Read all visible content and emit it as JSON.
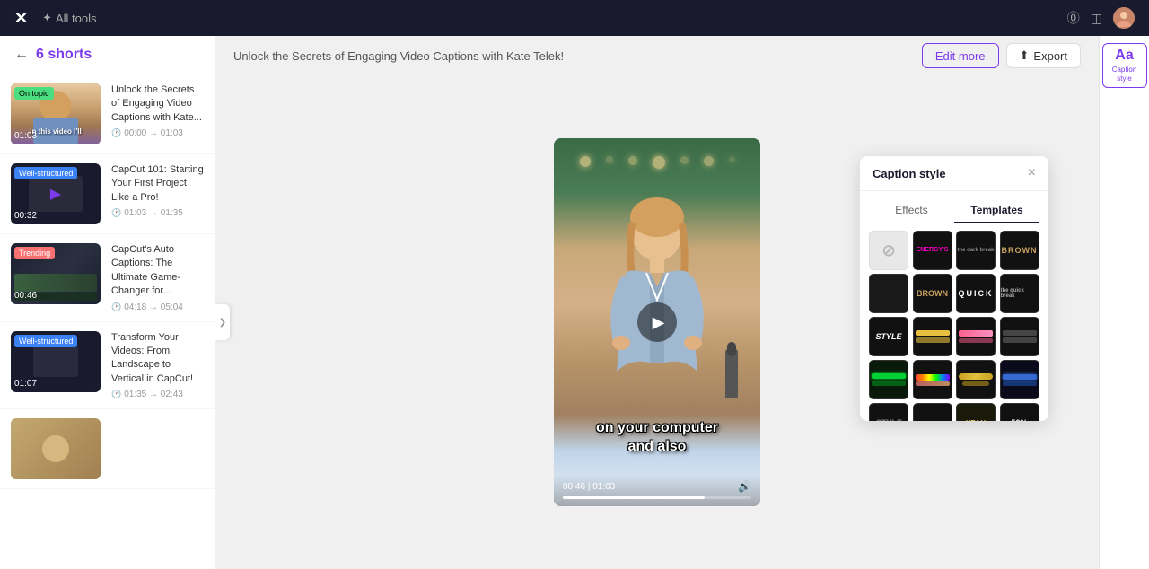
{
  "topnav": {
    "logo": "✕",
    "alltools_label": "All tools",
    "help_icon": "?",
    "history_icon": "📋",
    "avatar": "👤"
  },
  "sidebar": {
    "back_label": "←",
    "count": "6",
    "title": "shorts",
    "items": [
      {
        "id": "item-1",
        "badge": "On topic",
        "badge_type": "ontopic",
        "duration": "01:03",
        "title": "Unlock the Secrets of Engaging Video Captions with Kate...",
        "time_range": "00:00 → 01:03",
        "thumb_class": "thumb-gradient-1",
        "has_person": true,
        "caption_text": "in this video I'll"
      },
      {
        "id": "item-2",
        "badge": "Well-structured",
        "badge_type": "wellstructured",
        "duration": "00:32",
        "title": "CapCut 101: Starting Your First Project Like a Pro!",
        "time_range": "01:03 → 01:35",
        "thumb_class": "thumb-gradient-2",
        "has_person": false
      },
      {
        "id": "item-3",
        "badge": "Trending",
        "badge_type": "trending",
        "duration": "00:46",
        "title": "CapCut's Auto Captions: The Ultimate Game-Changer for...",
        "time_range": "04:18 → 05:04",
        "thumb_class": "thumb-gradient-3",
        "has_person": false
      },
      {
        "id": "item-4",
        "badge": "Well-structured",
        "badge_type": "wellstructured",
        "duration": "01:07",
        "title": "Transform Your Videos: From Landscape to Vertical in CapCut!",
        "time_range": "01:35 → 02:43",
        "thumb_class": "thumb-gradient-4",
        "has_person": false
      }
    ]
  },
  "content_header": {
    "text": "Unlock the Secrets of Engaging Video Captions with Kate Telek!",
    "edit_more_label": "Edit more",
    "export_label": "Export",
    "export_icon": "⬆"
  },
  "video": {
    "current_time": "00:46",
    "total_time": "01:03",
    "progress_pct": 75,
    "caption_line1": "on your computer",
    "caption_line2": "and also"
  },
  "caption_panel": {
    "title": "Caption style",
    "close_icon": "×",
    "tabs": [
      {
        "label": "Effects",
        "active": false
      },
      {
        "label": "Templates",
        "active": true
      }
    ],
    "styles": [
      {
        "id": "none",
        "bg": "#f0f0f0",
        "text": "",
        "icon": "🚫"
      },
      {
        "id": "energy",
        "bg": "#000",
        "text": "ENERGY'S",
        "text_color": "#ff00aa",
        "outline": "#ff00aa"
      },
      {
        "id": "dark-break",
        "bg": "#111",
        "text": "the dark break",
        "text_color": "#fff",
        "small": true
      },
      {
        "id": "brown-bold",
        "bg": "#111",
        "text": "BROWN",
        "text_color": "#c8a060",
        "bold": true
      },
      {
        "id": "dark1",
        "bg": "#1a1a1a",
        "text": "",
        "empty": true
      },
      {
        "id": "brown2",
        "bg": "#111",
        "text": "BROWN",
        "text_color": "#c8a060"
      },
      {
        "id": "quick",
        "bg": "#111",
        "text": "QUICK",
        "text_color": "#fff",
        "bold": true
      },
      {
        "id": "quick-break",
        "bg": "#111",
        "text": "the quick break",
        "text_color": "#fff",
        "small": true
      },
      {
        "id": "style",
        "bg": "#111",
        "text": "STYLE",
        "text_color": "#fff",
        "italic": true
      },
      {
        "id": "yellow-stripe",
        "bg": "#111",
        "text": "",
        "stripe": "yellow"
      },
      {
        "id": "pink-stripe",
        "bg": "#111",
        "text": "",
        "stripe": "pink"
      },
      {
        "id": "dark-stripe",
        "bg": "#111",
        "text": "",
        "stripe": "dark"
      },
      {
        "id": "neon-green",
        "bg": "#0a1a0a",
        "text": "",
        "neon": "green"
      },
      {
        "id": "colorful",
        "bg": "#111",
        "text": "",
        "colorful": true
      },
      {
        "id": "gold",
        "bg": "#111",
        "text": "",
        "gold": true
      },
      {
        "id": "neon-blue",
        "bg": "#0a0a1a",
        "text": "",
        "neon": "blue"
      },
      {
        "id": "style2",
        "bg": "#111",
        "text": "STYLE",
        "text_color": "#888"
      },
      {
        "id": "s2",
        "bg": "#111",
        "text": "",
        "empty": true
      },
      {
        "id": "s3",
        "bg": "#111",
        "text": "",
        "empty": true
      },
      {
        "id": "s4",
        "bg": "#111",
        "text": "50%",
        "text_color": "#fff"
      }
    ]
  },
  "caption_style_tool": {
    "icon": "Aa",
    "label": "Caption\nstyle",
    "active": true
  }
}
